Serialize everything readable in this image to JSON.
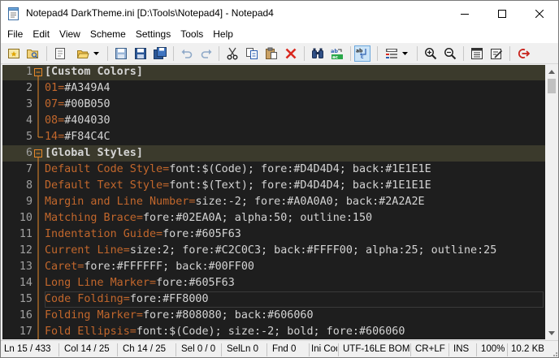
{
  "window": {
    "title": "Notepad4 DarkTheme.ini [D:\\Tools\\Notepad4] - Notepad4"
  },
  "menu": [
    "File",
    "Edit",
    "View",
    "Scheme",
    "Settings",
    "Tools",
    "Help"
  ],
  "toolbar": {
    "icons": [
      "new-file-icon",
      "open-file-icon",
      "browse-icon",
      "open-folder-icon",
      "save-icon",
      "save-as-icon",
      "save-all-icon",
      "undo-icon",
      "redo-icon",
      "cut-icon",
      "copy-icon",
      "paste-icon",
      "delete-icon",
      "find-icon",
      "replace-icon",
      "word-wrap-icon",
      "scheme-icon",
      "zoom-in-icon",
      "zoom-out-icon",
      "properties-icon",
      "edit-settings-icon",
      "exit-icon"
    ],
    "active": "word-wrap-icon"
  },
  "editor": {
    "lines": [
      {
        "num": "1",
        "type": "section",
        "text": "[Custom Colors]"
      },
      {
        "num": "2",
        "type": "entry",
        "key": "01=",
        "value": "#A349A4"
      },
      {
        "num": "3",
        "type": "entry",
        "key": "07=",
        "value": "#00B050"
      },
      {
        "num": "4",
        "type": "entry",
        "key": "08=",
        "value": "#404030"
      },
      {
        "num": "5",
        "type": "entry",
        "key": "14=",
        "value": "#F84C4C"
      },
      {
        "num": "6",
        "type": "section",
        "text": "[Global Styles]"
      },
      {
        "num": "7",
        "type": "entry",
        "key": "Default Code Style=",
        "value": "font:$(Code); fore:#D4D4D4; back:#1E1E1E"
      },
      {
        "num": "8",
        "type": "entry",
        "key": "Default Text Style=",
        "value": "font:$(Text); fore:#D4D4D4; back:#1E1E1E"
      },
      {
        "num": "9",
        "type": "entry",
        "key": "Margin and Line Number=",
        "value": "size:-2; fore:#A0A0A0; back:#2A2A2E"
      },
      {
        "num": "10",
        "type": "entry",
        "key": "Matching Brace=",
        "value": "fore:#02EA0A; alpha:50; outline:150"
      },
      {
        "num": "11",
        "type": "entry",
        "key": "Indentation Guide=",
        "value": "fore:#605F63"
      },
      {
        "num": "12",
        "type": "entry",
        "key": "Current Line=",
        "value": "size:2; fore:#C2C0C3; back:#FFFF00; alpha:25; outline:25"
      },
      {
        "num": "13",
        "type": "entry",
        "key": "Caret=",
        "value": "fore:#FFFFFF; back:#00FF00"
      },
      {
        "num": "14",
        "type": "entry",
        "key": "Long Line Marker=",
        "value": "fore:#605F63"
      },
      {
        "num": "15",
        "type": "entry",
        "key": "Code Folding=",
        "value": "fore:#FF8000"
      },
      {
        "num": "16",
        "type": "entry",
        "key": "Folding Marker=",
        "value": "fore:#808080; back:#606060"
      },
      {
        "num": "17",
        "type": "entry",
        "key": "Fold Ellipsis=",
        "value": "font:$(Code); size:-2; bold; fore:#606060"
      }
    ],
    "current_line": "15",
    "colors": {
      "background": "#1E1E1E",
      "key": "#C2672C",
      "value": "#D4D4D4",
      "line_number": "#A0A0A0",
      "section_band": "#3B3A2C",
      "fold_marker": "#E8892A"
    }
  },
  "status": {
    "ln": "Ln 15 / 433",
    "col": "Col 14 / 25",
    "ch": "Ch 14 / 25",
    "sel": "Sel 0 / 0",
    "selln": "SelLn 0",
    "fnd": "Fnd 0",
    "ini": "Ini",
    "cod": "Cod",
    "encoding": "UTF-16LE BOM",
    "eol": "CR+LF",
    "ins": "INS",
    "zoom": "100%",
    "size": "10.2 KB"
  }
}
